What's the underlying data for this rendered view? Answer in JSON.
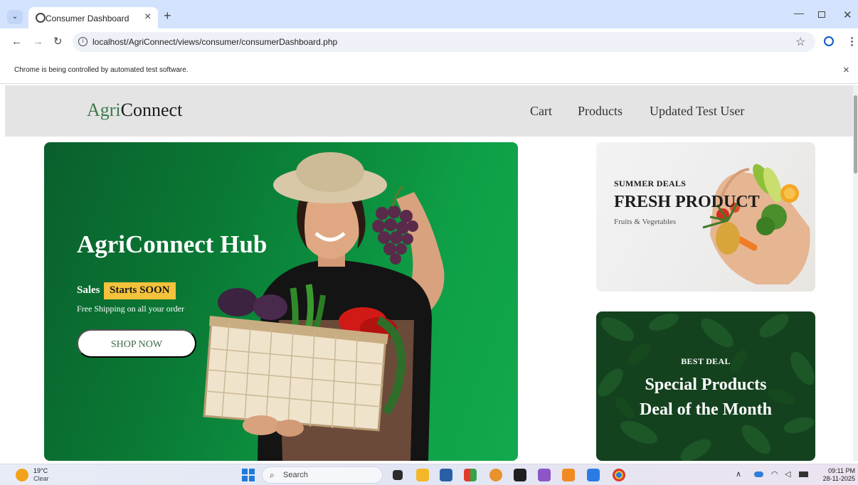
{
  "browser": {
    "tab_title": "Consumer Dashboard",
    "url": "localhost/AgriConnect/views/consumer/consumerDashboard.php",
    "infobar_text": "Chrome is being controlled by automated test software."
  },
  "site": {
    "logo_part1": "Agri",
    "logo_part2": "Connect",
    "nav": {
      "cart": "Cart",
      "products": "Products",
      "user": "Updated Test User"
    }
  },
  "hero": {
    "title": "AgriConnect Hub",
    "sales_label": "Sales",
    "sales_badge": "Starts SOON",
    "shipping": "Free Shipping on all your order",
    "button": "SHOP NOW"
  },
  "summer_card": {
    "kicker": "SUMMER DEALS",
    "title": "FRESH PRODUCT",
    "subtitle": "Fruits & Vegetables"
  },
  "deal_card": {
    "kicker": "BEST DEAL",
    "title_line1": "Special Products",
    "title_line2": "Deal of the Month"
  },
  "taskbar": {
    "weather_temp": "19°C",
    "weather_condition": "Clear",
    "search_placeholder": "Search",
    "time": "09:11 PM",
    "date": "28-11-2025"
  },
  "colors": {
    "hero_green": "#0a7a35",
    "badge_yellow": "#f4c23b",
    "deal_green": "#14421f",
    "header_gray": "#e4e4e4",
    "logo_green": "#3d7a49"
  }
}
